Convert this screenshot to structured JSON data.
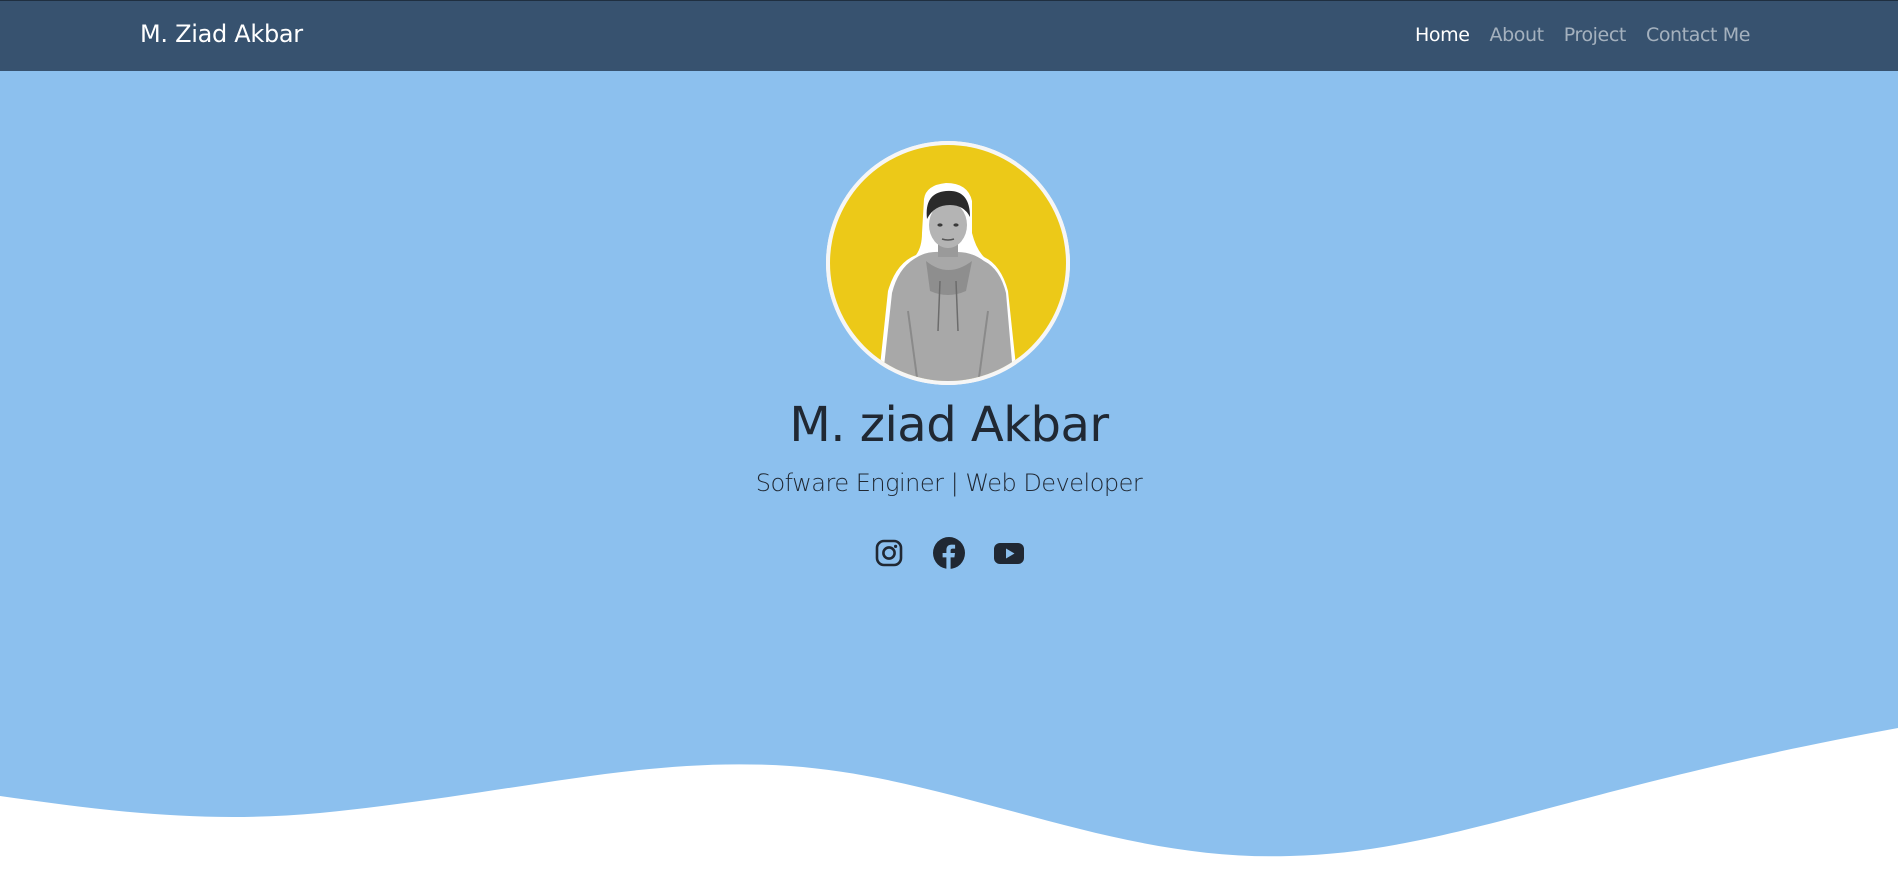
{
  "navbar": {
    "brand": "M. Ziad Akbar",
    "links": [
      {
        "label": "Home",
        "active": true
      },
      {
        "label": "About",
        "active": false
      },
      {
        "label": "Project",
        "active": false
      },
      {
        "label": "Contact Me",
        "active": false
      }
    ]
  },
  "hero": {
    "name": "M. ziad Akbar",
    "role": "Sofware Enginer | Web Developer",
    "socials": [
      {
        "icon": "instagram-icon"
      },
      {
        "icon": "facebook-icon"
      },
      {
        "icon": "youtube-icon"
      }
    ]
  },
  "colors": {
    "navbar_bg": "#37526f",
    "hero_bg": "#8cc0ee",
    "avatar_bg": "#ecc918",
    "text_dark": "#202833",
    "wave": "#ffffff"
  }
}
